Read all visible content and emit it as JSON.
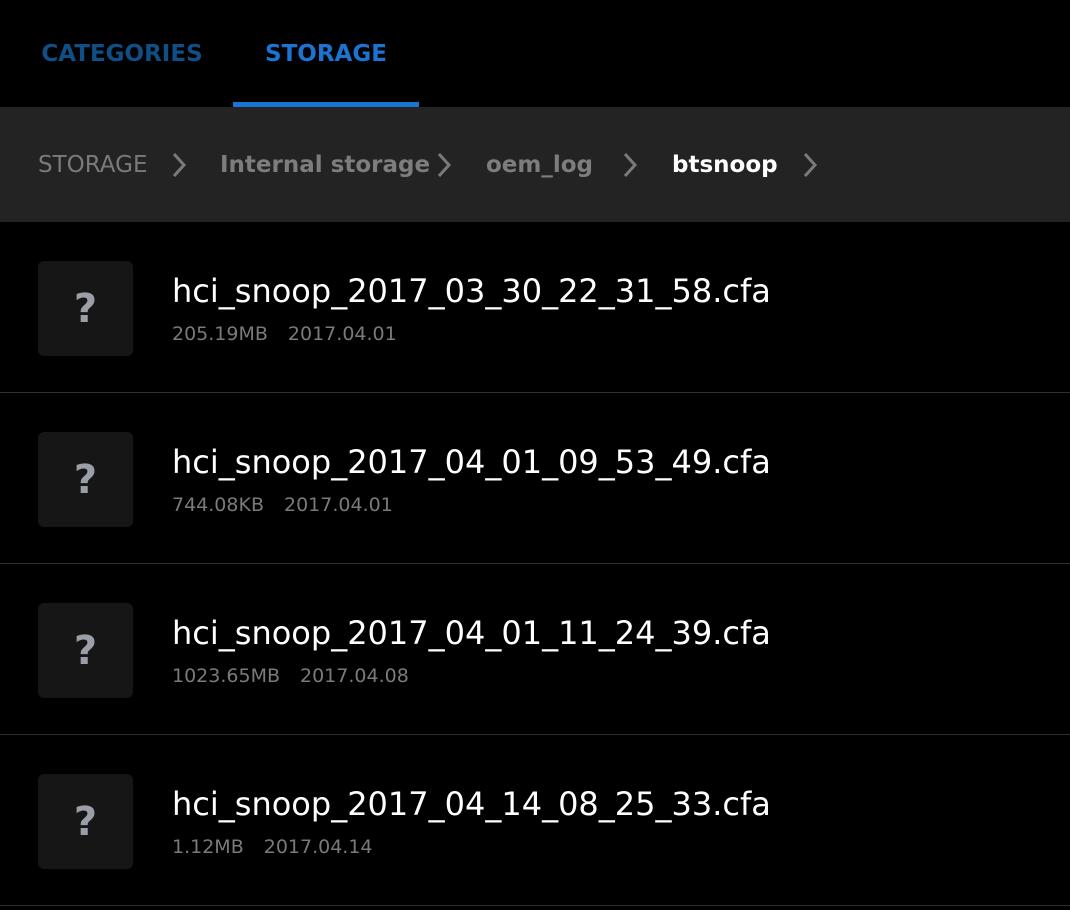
{
  "tabs": [
    {
      "label": "CATEGORIES",
      "active": false
    },
    {
      "label": "STORAGE",
      "active": true
    }
  ],
  "colors": {
    "accent": "#1a74d2",
    "inactive_tab": "#0f4f86",
    "breadcrumb_bg": "#232323",
    "background": "#000000"
  },
  "breadcrumb": {
    "items": [
      "STORAGE",
      "Internal storage",
      "oem_log",
      "btsnoop"
    ],
    "separator_icon": "chevron-right-icon"
  },
  "files": [
    {
      "name": "hci_snoop_2017_03_30_22_31_58.cfa",
      "size": "205.19MB",
      "date": "2017.04.01",
      "icon": "unknown-file-icon"
    },
    {
      "name": "hci_snoop_2017_04_01_09_53_49.cfa",
      "size": "744.08KB",
      "date": "2017.04.01",
      "icon": "unknown-file-icon"
    },
    {
      "name": "hci_snoop_2017_04_01_11_24_39.cfa",
      "size": "1023.65MB",
      "date": "2017.04.08",
      "icon": "unknown-file-icon"
    },
    {
      "name": "hci_snoop_2017_04_14_08_25_33.cfa",
      "size": "1.12MB",
      "date": "2017.04.14",
      "icon": "unknown-file-icon"
    }
  ],
  "file_icon_glyph": "?"
}
